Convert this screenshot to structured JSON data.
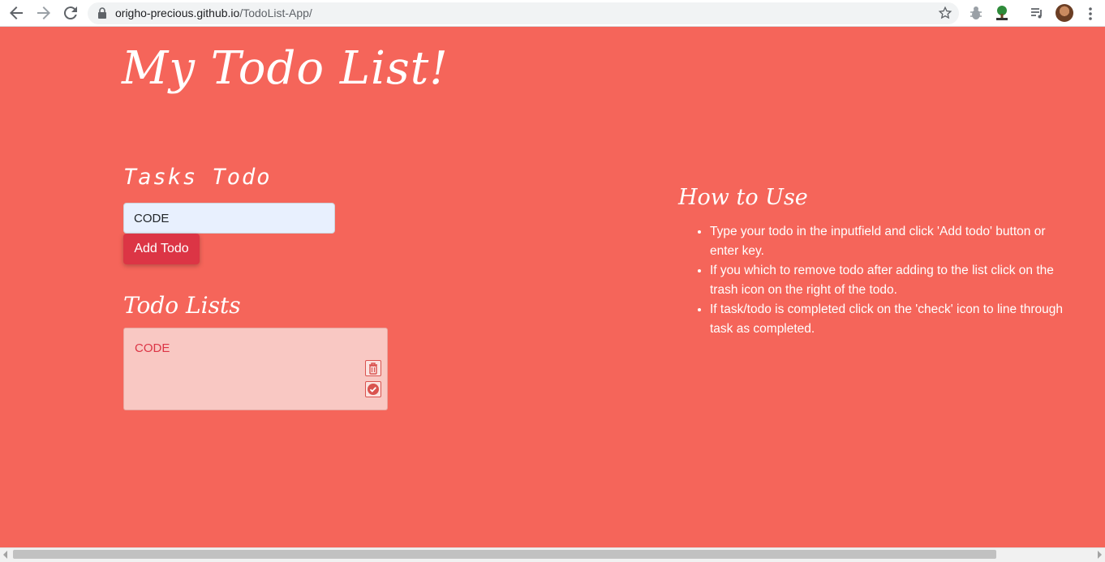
{
  "browser": {
    "url_host": "origho-precious.github.io",
    "url_path": "/TodoList-App/"
  },
  "page": {
    "title": "My Todo List!",
    "tasks_heading": "Tasks Todo",
    "input_value": "CODE",
    "add_button_label": "Add Todo",
    "lists_heading": "Todo Lists",
    "todos": [
      {
        "text": "CODE"
      }
    ],
    "howto": {
      "heading": "How to Use",
      "items": [
        "Type your todo in the inputfield and click 'Add todo' button or enter key.",
        "If you which to remove todo after adding to the list click on the trash icon on the right of the todo.",
        "If task/todo is completed click on the 'check' icon to line through task as completed."
      ]
    }
  },
  "colors": {
    "background": "#f5655a",
    "button": "#dc3545",
    "card": "#f9c8c3",
    "input": "#e8f0fe"
  }
}
